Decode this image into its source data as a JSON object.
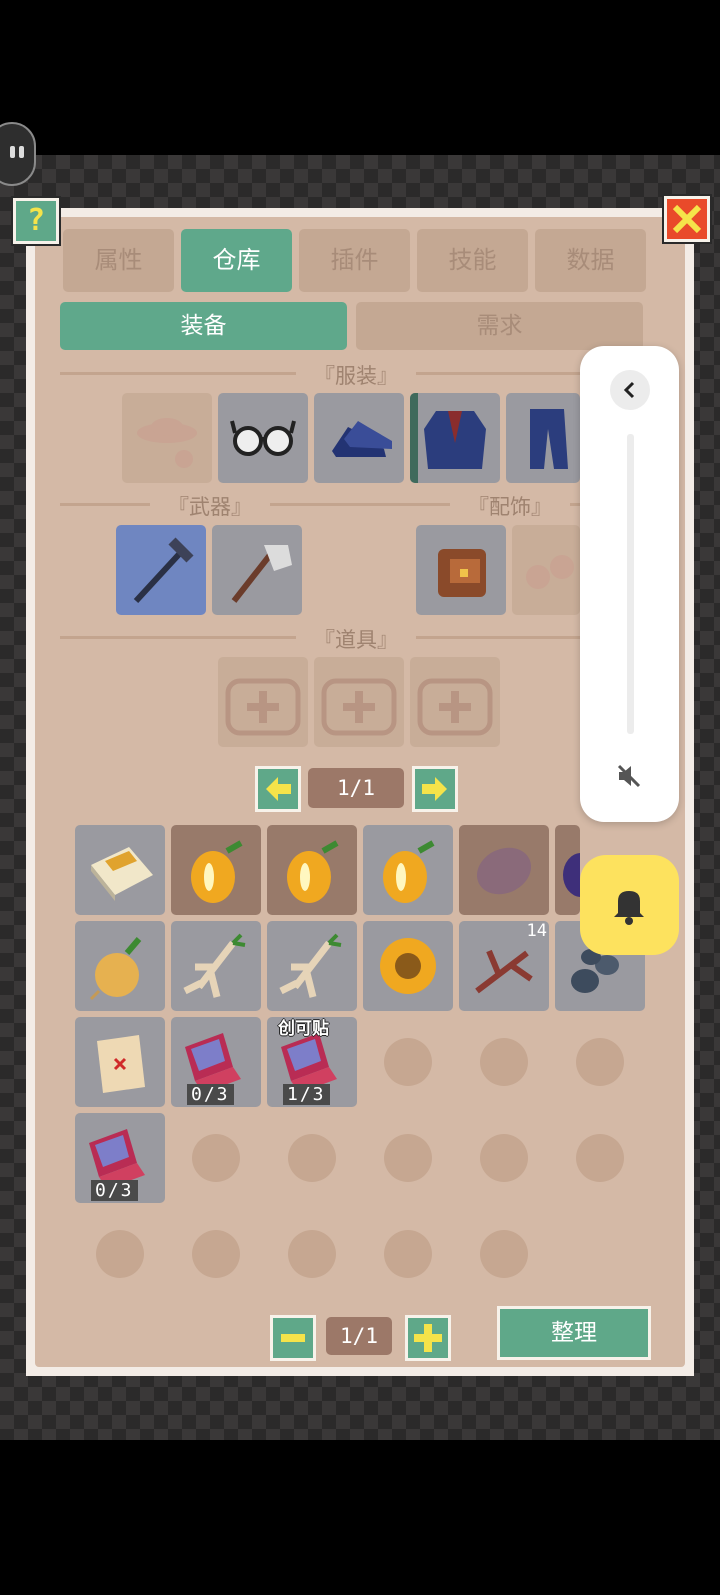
{
  "tabs": [
    {
      "label": "属性",
      "active": false
    },
    {
      "label": "仓库",
      "active": true
    },
    {
      "label": "插件",
      "active": false
    },
    {
      "label": "技能",
      "active": false
    },
    {
      "label": "数据",
      "active": false
    }
  ],
  "subtabs": [
    {
      "label": "装备",
      "active": true
    },
    {
      "label": "需求",
      "active": false
    }
  ],
  "sections": {
    "clothing": "『服装』",
    "weapons": "『武器』",
    "accessories": "『配饰』",
    "tools": "『道具』"
  },
  "help_label": "?",
  "equip_pager": {
    "label": "1/1"
  },
  "inventory": {
    "items": [
      {
        "name": "cigarette-pack-icon"
      },
      {
        "name": "yellow-pepper-icon"
      },
      {
        "name": "yellow-pepper-icon"
      },
      {
        "name": "yellow-pepper-icon"
      },
      {
        "name": "potato-icon"
      },
      {
        "name": "eggplant-icon"
      },
      {
        "name": "onion-icon"
      },
      {
        "name": "ginseng-root-icon"
      },
      {
        "name": "ginseng-root-icon"
      },
      {
        "name": "sunflower-icon"
      },
      {
        "name": "branch-icon",
        "count": "14"
      },
      {
        "name": "stones-icon"
      },
      {
        "name": "treasure-map-icon"
      },
      {
        "name": "bandage-kit-icon",
        "uses": "0/3"
      },
      {
        "name": "bandage-kit-icon",
        "uses": "1/3",
        "label": "创可贴"
      },
      {
        "name": "bandage-kit-icon",
        "uses": "0/3"
      }
    ],
    "pager": {
      "label": "1/1"
    },
    "sort_label": "整理"
  }
}
